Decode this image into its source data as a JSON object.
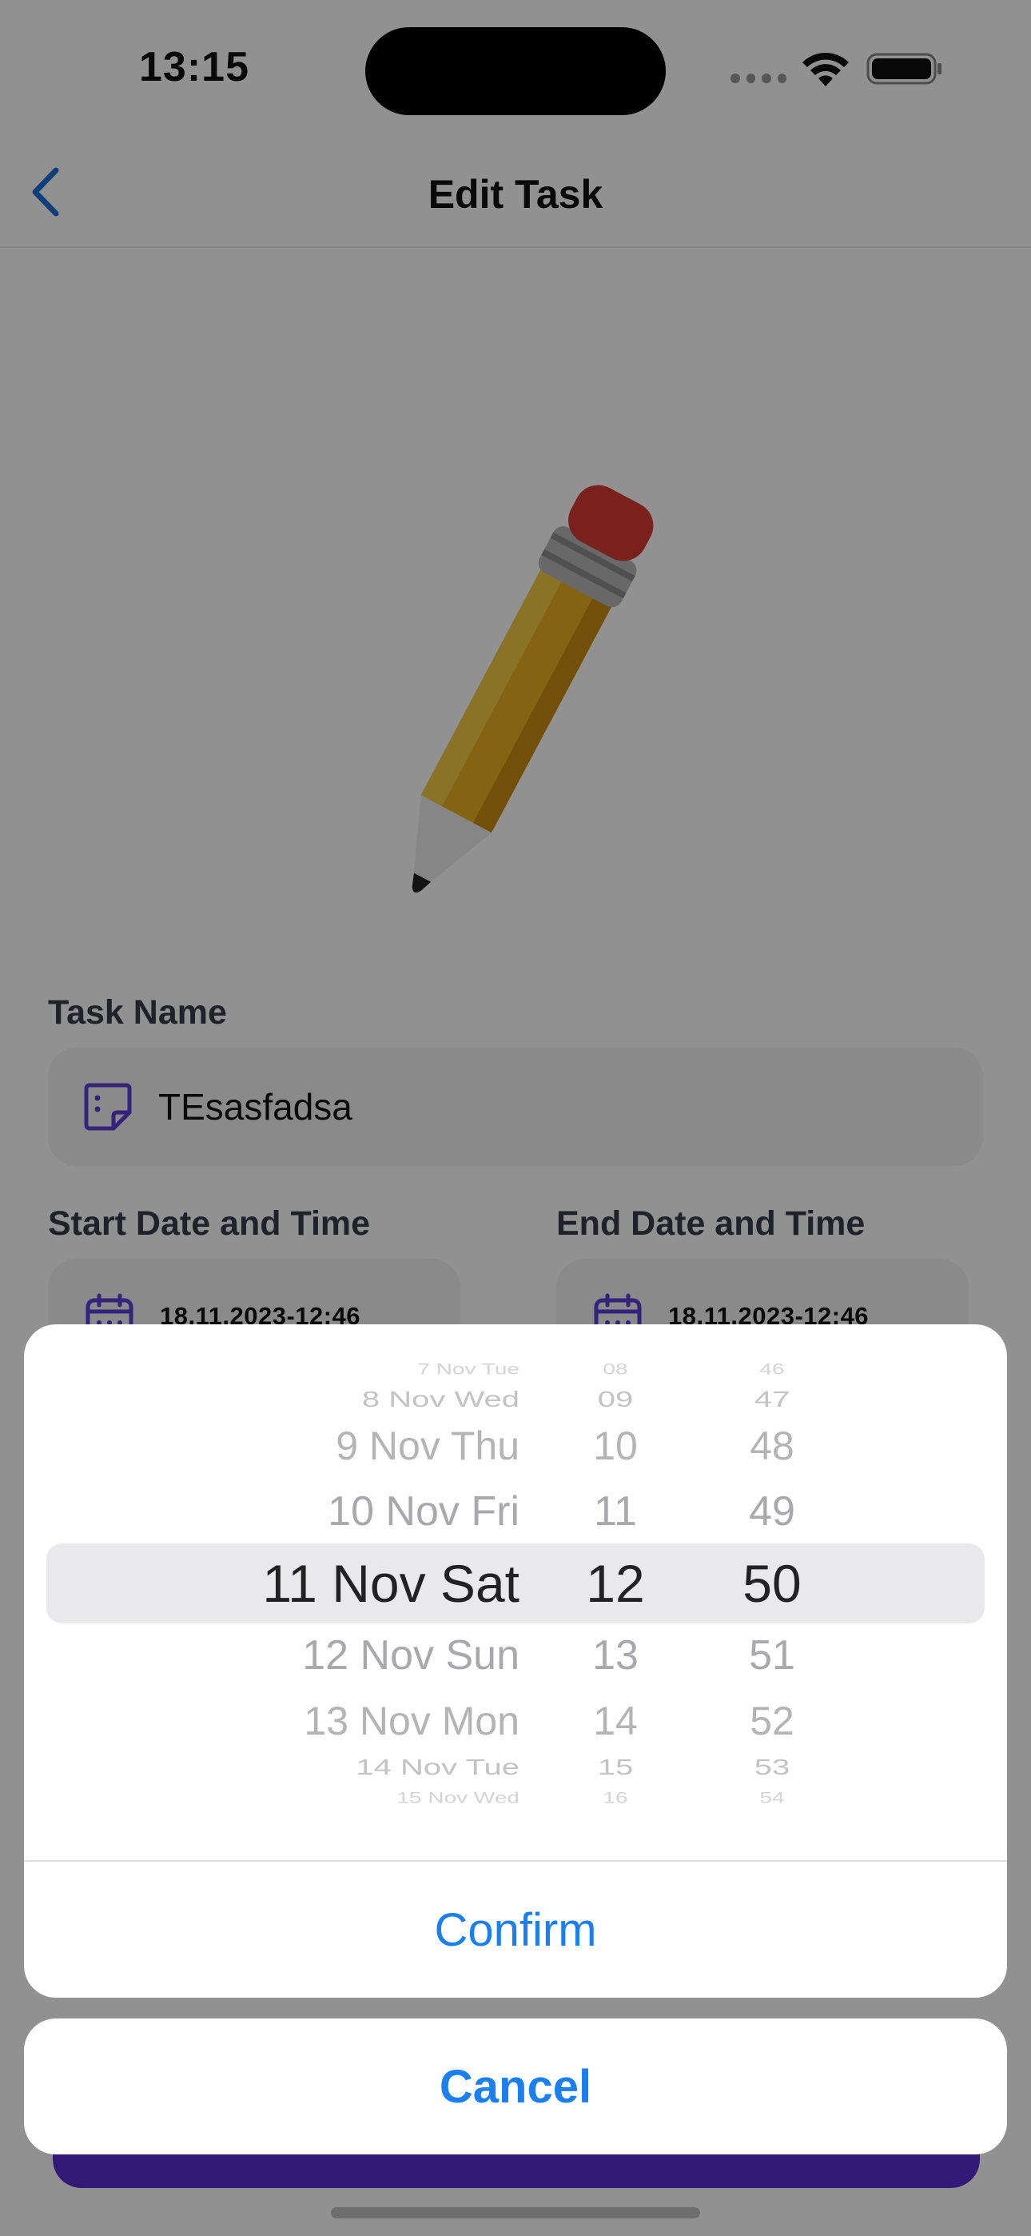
{
  "status_bar": {
    "time": "13:15"
  },
  "nav": {
    "title": "Edit Task"
  },
  "form": {
    "task_name_label": "Task Name",
    "task_name_value": "TEsasfadsa",
    "start_label": "Start Date and Time",
    "start_value": "18.11.2023-12:46",
    "end_label": "End Date and Time",
    "end_value": "18.11.2023-12:46"
  },
  "picker": {
    "rows": [
      {
        "day": "7 Nov Tue",
        "hour": "08",
        "minute": "46"
      },
      {
        "day": "8 Nov Wed",
        "hour": "09",
        "minute": "47"
      },
      {
        "day": "9 Nov Thu",
        "hour": "10",
        "minute": "48"
      },
      {
        "day": "10 Nov Fri",
        "hour": "11",
        "minute": "49"
      },
      {
        "day": "11 Nov Sat",
        "hour": "12",
        "minute": "50"
      },
      {
        "day": "12 Nov Sun",
        "hour": "13",
        "minute": "51"
      },
      {
        "day": "13 Nov Mon",
        "hour": "14",
        "minute": "52"
      },
      {
        "day": "14 Nov Tue",
        "hour": "15",
        "minute": "53"
      },
      {
        "day": "15 Nov Wed",
        "hour": "16",
        "minute": "54"
      }
    ],
    "selected_index": 4
  },
  "actions": {
    "confirm_label": "Confirm",
    "cancel_label": "Cancel"
  },
  "colors": {
    "accent": "#1a7ff0",
    "brand": "#5a2ed0",
    "icon": "#5b3fd6"
  }
}
